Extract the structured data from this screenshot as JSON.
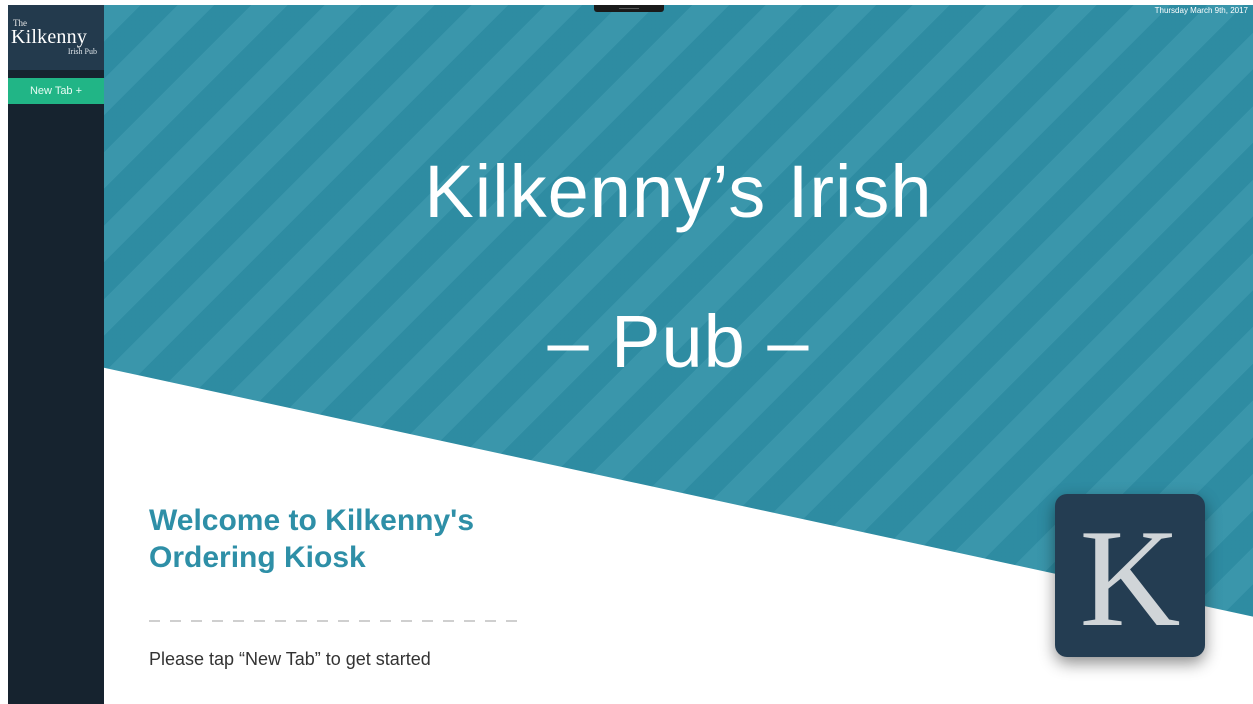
{
  "sidebar": {
    "logo": {
      "the": "The",
      "name": "Kilkenny",
      "sub": "Irish Pub"
    },
    "new_tab_label": "New Tab +"
  },
  "header": {
    "date": "Thursday March 9th, 2017"
  },
  "hero": {
    "title_line1": "Kilkenny’s Irish",
    "title_line2": "– Pub –"
  },
  "welcome": {
    "heading_line1": "Welcome to Kilkenny's",
    "heading_line2": "Ordering Kiosk",
    "prompt": "Please tap “New Tab” to get started"
  },
  "app_icon": {
    "letter": "K"
  },
  "colors": {
    "sidebar": "#16232f",
    "logo_bg": "#233a4d",
    "accent_green": "#21b586",
    "hero_teal": "#2f90a7",
    "heading_teal": "#2e8fa7",
    "icon_bg": "#243d52"
  }
}
